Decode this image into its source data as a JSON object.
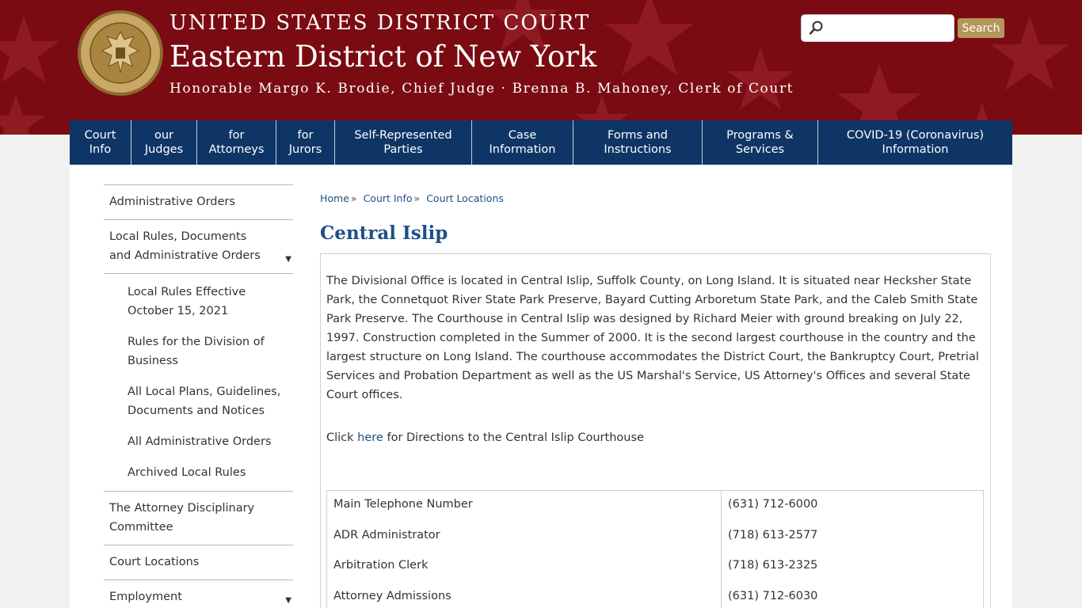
{
  "header": {
    "court_name": "UNITED STATES DISTRICT COURT",
    "district_name": "Eastern District of New York",
    "officials": "Honorable Margo K. Brodie, Chief Judge · Brenna B. Mahoney, Clerk of Court",
    "seal_icon": "court-seal-icon",
    "colors": {
      "banner": "#7a0b12",
      "nav": "#0f3566",
      "accent": "#b5965a",
      "link": "#1f4f86"
    }
  },
  "search": {
    "placeholder": "",
    "value": "",
    "button_label": "Search"
  },
  "nav": {
    "items": [
      {
        "line1": "Court",
        "line2": "Info"
      },
      {
        "line1": "our",
        "line2": "Judges"
      },
      {
        "line1": "for",
        "line2": "Attorneys"
      },
      {
        "line1": "for",
        "line2": "Jurors"
      },
      {
        "line1": "Self-Represented",
        "line2": "Parties"
      },
      {
        "line1": "Case",
        "line2": "Information"
      },
      {
        "line1": "Forms and",
        "line2": "Instructions"
      },
      {
        "line1": "Programs &",
        "line2": "Services"
      },
      {
        "line1": "COVID-19 (Coronavirus)",
        "line2": "Information"
      }
    ]
  },
  "sidebar": {
    "items": [
      {
        "label": "Administrative Orders"
      },
      {
        "label": "Local Rules, Documents and Administrative Orders",
        "expandable": true,
        "children": [
          "Local Rules Effective October 15, 2021",
          "Rules for the Division of Business",
          "All Local Plans, Guidelines, Documents and Notices",
          "All Administrative Orders",
          "Archived Local Rules"
        ]
      },
      {
        "label": "The Attorney Disciplinary Committee"
      },
      {
        "label": "Court Locations"
      },
      {
        "label": "Employment",
        "expandable": true
      }
    ]
  },
  "breadcrumb": {
    "items": [
      "Home",
      "Court Info",
      "Court Locations"
    ],
    "separator": "»"
  },
  "page": {
    "title": "Central Islip",
    "description": "The Divisional Office is located in Central Islip, Suffolk County, on Long Island. It is situated near Hecksher State Park, the Connetquot River State Park Preserve, Bayard Cutting Arboretum State Park, and the Caleb Smith State Park Preserve. The Courthouse in Central Islip was designed by Richard Meier with ground breaking on July 22, 1997. Construction completed in the Summer of 2000. It is the second largest courthouse in the country and the largest structure on Long Island. The courthouse accommodates the District Court, the Bankruptcy Court, Pretrial Services and Probation Department as well as the US Marshal's Service, US Attorney's Offices and several  State Court offices.",
    "click_prefix": "Click ",
    "click_link": "here",
    "click_suffix": " for Directions to the Central Islip Courthouse"
  },
  "phones": [
    {
      "label": "Main Telephone Number",
      "number": "(631) 712-6000"
    },
    {
      "label": "ADR Administrator",
      "number": "(718) 613-2577"
    },
    {
      "label": "Arbitration Clerk",
      "number": "(718) 613-2325"
    },
    {
      "label": "Attorney Admissions",
      "number": "(631) 712-6030"
    }
  ]
}
